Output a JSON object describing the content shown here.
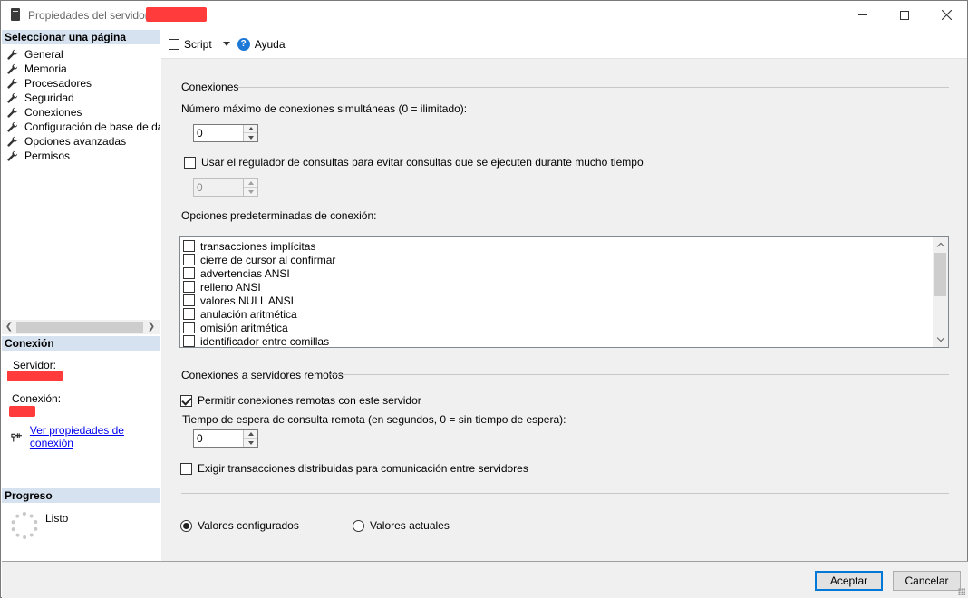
{
  "window": {
    "title": "Propiedades del servidor:"
  },
  "left": {
    "select_page_header": "Seleccionar una página",
    "pages": [
      {
        "label": "General"
      },
      {
        "label": "Memoria"
      },
      {
        "label": "Procesadores"
      },
      {
        "label": "Seguridad"
      },
      {
        "label": "Conexiones"
      },
      {
        "label": "Configuración de base de datos"
      },
      {
        "label": "Opciones avanzadas"
      },
      {
        "label": "Permisos"
      }
    ],
    "connection_header": "Conexión",
    "server_label": "Servidor:",
    "connection_label": "Conexión:",
    "view_connection_props": "Ver propiedades de conexión",
    "progress_header": "Progreso",
    "progress_status": "Listo"
  },
  "toolbar": {
    "script_label": "Script",
    "help_label": "Ayuda"
  },
  "connections": {
    "group_title": "Conexiones",
    "max_connections_label": "Número máximo de conexiones simultáneas (0 = ilimitado):",
    "max_connections_value": "0",
    "governor_label": "Usar el regulador de consultas para evitar consultas que se ejecuten durante mucho tiempo",
    "governor_checked": false,
    "governor_value": "0",
    "default_options_label": "Opciones predeterminadas de conexión:",
    "default_options": [
      {
        "label": "transacciones implícitas",
        "checked": false
      },
      {
        "label": "cierre de cursor al confirmar",
        "checked": false
      },
      {
        "label": "advertencias ANSI",
        "checked": false
      },
      {
        "label": "relleno ANSI",
        "checked": false
      },
      {
        "label": "valores NULL ANSI",
        "checked": false
      },
      {
        "label": "anulación aritmética",
        "checked": false
      },
      {
        "label": "omisión aritmética",
        "checked": false
      },
      {
        "label": "identificador entre comillas",
        "checked": false
      }
    ]
  },
  "remote": {
    "group_title": "Conexiones a servidores remotos",
    "allow_remote_label": "Permitir conexiones remotas con este servidor",
    "allow_remote_checked": true,
    "timeout_label": "Tiempo de espera de consulta remota (en segundos, 0 = sin tiempo de espera):",
    "timeout_value": "0",
    "distributed_tx_label": "Exigir transacciones distribuidas para comunicación entre servidores",
    "distributed_tx_checked": false
  },
  "values_mode": {
    "configured_label": "Valores configurados",
    "current_label": "Valores actuales",
    "selected": "configured"
  },
  "buttons": {
    "accept": "Aceptar",
    "cancel": "Cancelar"
  },
  "colors": {
    "section_header_bg": "#d6e2f0",
    "redaction": "#ff3b3b",
    "link": "#0000ee",
    "primary_border": "#0078d7"
  }
}
